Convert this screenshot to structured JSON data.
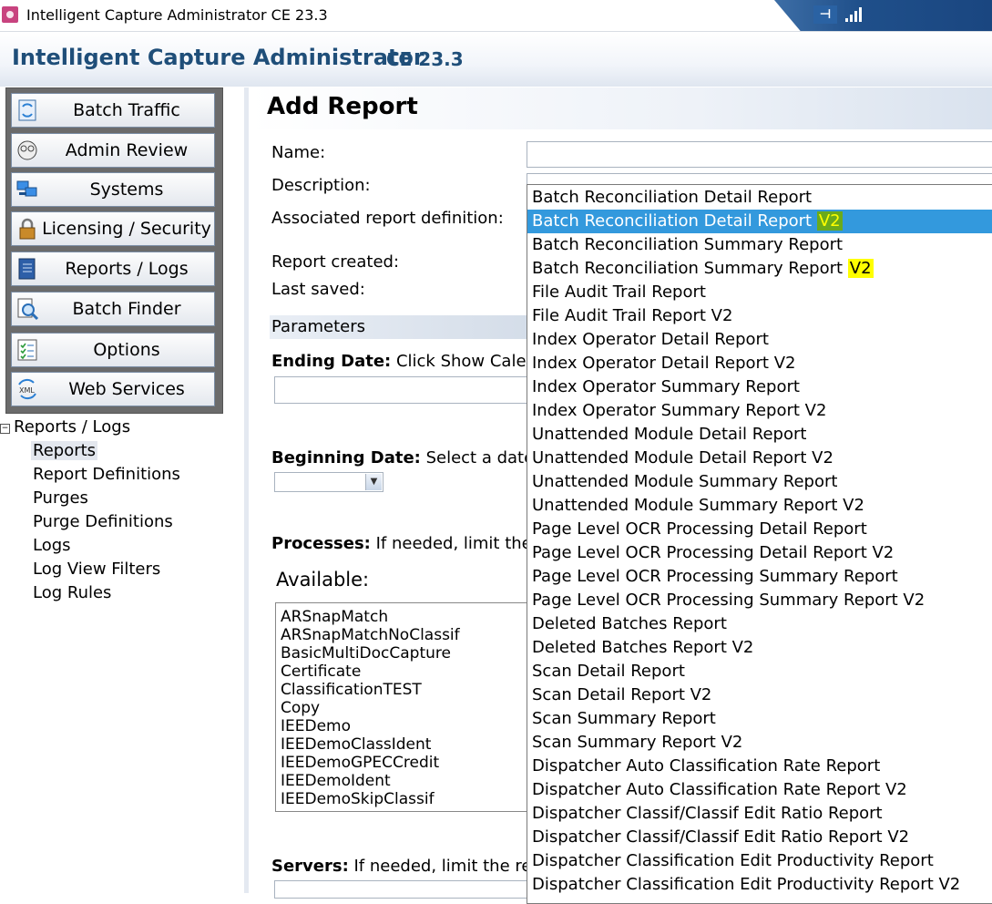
{
  "window": {
    "title": "Intelligent Capture Administrator CE 23.3"
  },
  "header": {
    "app_name": "Intelligent Capture Administrator",
    "version": "CE 23.3"
  },
  "nav": {
    "buttons": [
      {
        "label": "Batch Traffic",
        "icon": "batch-traffic-icon"
      },
      {
        "label": "Admin Review",
        "icon": "admin-review-icon"
      },
      {
        "label": "Systems",
        "icon": "systems-icon"
      },
      {
        "label": "Licensing / Security",
        "icon": "lock-icon"
      },
      {
        "label": "Reports / Logs",
        "icon": "reports-icon"
      },
      {
        "label": "Batch Finder",
        "icon": "magnifier-icon"
      },
      {
        "label": "Options",
        "icon": "checklist-icon"
      },
      {
        "label": "Web Services",
        "icon": "xml-icon"
      }
    ]
  },
  "tree": {
    "root": "Reports / Logs",
    "toggle": "−",
    "items": [
      "Reports",
      "Report Definitions",
      "Purges",
      "Purge Definitions",
      "Logs",
      "Log View Filters",
      "Log Rules"
    ],
    "selected": "Reports"
  },
  "page": {
    "title": "Add Report",
    "name_label": "Name:",
    "description_label": "Description:",
    "assoc_label": "Associated report definition:",
    "created_label": "Report created:",
    "saved_label": "Last saved:",
    "parameters_label": "Parameters",
    "ending_label": "Ending Date:",
    "ending_text": " Click Show Calen",
    "beginning_label": "Beginning Date:",
    "beginning_text": " Select a date",
    "processes_label": "Processes:",
    "processes_text": " If needed, limit the",
    "available_label": "Available:",
    "servers_label": "Servers:",
    "servers_text": " If needed, limit the re"
  },
  "processes": [
    "ARSnapMatch",
    "ARSnapMatchNoClassif",
    "BasicMultiDocCapture",
    "Certificate",
    "ClassificationTEST",
    "Copy",
    "IEEDemo",
    "IEEDemoClassIdent",
    "IEEDemoGPECCredit",
    "IEEDemoIdent",
    "IEEDemoSkipClassif"
  ],
  "dropdown": {
    "highlighted_index": 1,
    "items": [
      {
        "text": "Batch Reconciliation Detail Report",
        "mark": ""
      },
      {
        "text": "Batch Reconciliation Detail Report ",
        "mark": "V2",
        "mark_style": "green"
      },
      {
        "text": "Batch Reconciliation Summary Report",
        "mark": ""
      },
      {
        "text": "Batch Reconciliation Summary Report ",
        "mark": "V2",
        "mark_style": "yellow"
      },
      {
        "text": "File Audit Trail Report",
        "mark": ""
      },
      {
        "text": "File Audit Trail Report V2",
        "mark": ""
      },
      {
        "text": "Index Operator Detail Report",
        "mark": ""
      },
      {
        "text": "Index Operator Detail Report V2",
        "mark": ""
      },
      {
        "text": "Index Operator Summary Report",
        "mark": ""
      },
      {
        "text": "Index Operator Summary Report V2",
        "mark": ""
      },
      {
        "text": "Unattended Module Detail Report",
        "mark": ""
      },
      {
        "text": "Unattended Module Detail Report V2",
        "mark": ""
      },
      {
        "text": "Unattended Module Summary Report",
        "mark": ""
      },
      {
        "text": "Unattended Module Summary Report V2",
        "mark": ""
      },
      {
        "text": "Page Level OCR Processing Detail Report",
        "mark": ""
      },
      {
        "text": "Page Level OCR Processing Detail Report V2",
        "mark": ""
      },
      {
        "text": "Page Level OCR Processing Summary Report",
        "mark": ""
      },
      {
        "text": "Page Level OCR Processing Summary Report V2",
        "mark": ""
      },
      {
        "text": "Deleted Batches Report",
        "mark": ""
      },
      {
        "text": "Deleted Batches Report V2",
        "mark": ""
      },
      {
        "text": "Scan Detail Report",
        "mark": ""
      },
      {
        "text": "Scan Detail Report V2",
        "mark": ""
      },
      {
        "text": "Scan Summary Report",
        "mark": ""
      },
      {
        "text": "Scan Summary Report V2",
        "mark": ""
      },
      {
        "text": "Dispatcher Auto Classification Rate Report",
        "mark": ""
      },
      {
        "text": "Dispatcher Auto Classification Rate Report V2",
        "mark": ""
      },
      {
        "text": "Dispatcher Classif/Classif Edit Ratio Report",
        "mark": ""
      },
      {
        "text": "Dispatcher Classif/Classif Edit Ratio Report V2",
        "mark": ""
      },
      {
        "text": "Dispatcher Classification Edit Productivity Report",
        "mark": ""
      },
      {
        "text": "Dispatcher Classification Edit Productivity Report V2",
        "mark": ""
      }
    ]
  },
  "colors": {
    "highlight": "#3399dd",
    "brand": "#1f4e79",
    "mark_yellow": "#ffff00",
    "mark_green": "#6aaa1c"
  }
}
